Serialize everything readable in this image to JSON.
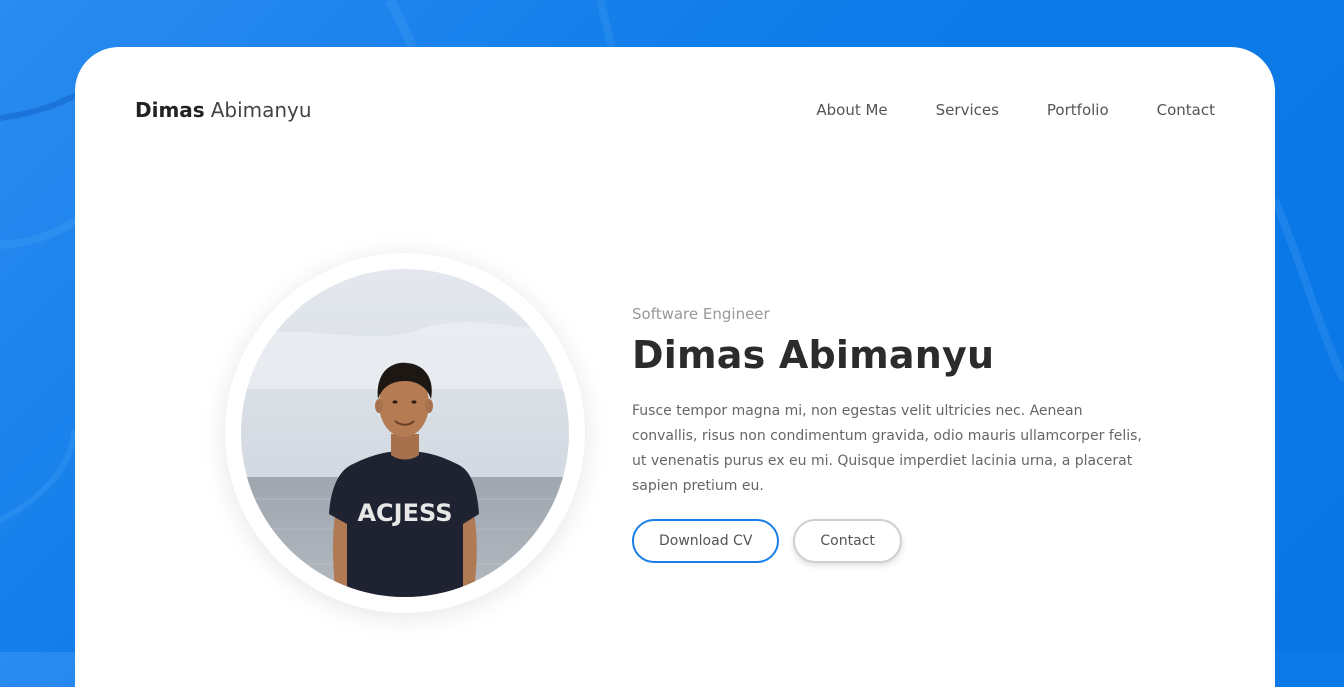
{
  "brand": {
    "first_name": "Dimas",
    "last_name": "Abimanyu"
  },
  "nav": {
    "items": [
      {
        "label": "About Me"
      },
      {
        "label": "Services"
      },
      {
        "label": "Portfolio"
      },
      {
        "label": "Contact"
      }
    ]
  },
  "hero": {
    "subtitle": "Software Engineer",
    "title": "Dimas Abimanyu",
    "description": "Fusce tempor magna mi, non egestas velit ultricies nec. Aenean convallis, risus non condimentum gravida, odio mauris ullamcorper felis, ut venenatis purus ex eu mi. Quisque imperdiet lacinia urna, a placerat sapien pretium eu.",
    "buttons": {
      "download_cv": "Download CV",
      "contact": "Contact"
    },
    "photo": {
      "shirt_text": "ACJESS"
    }
  },
  "colors": {
    "accent": "#1a7fe6",
    "background": "#0d7be8",
    "card": "#ffffff",
    "heading": "#2b2b2b",
    "muted": "#999999"
  }
}
